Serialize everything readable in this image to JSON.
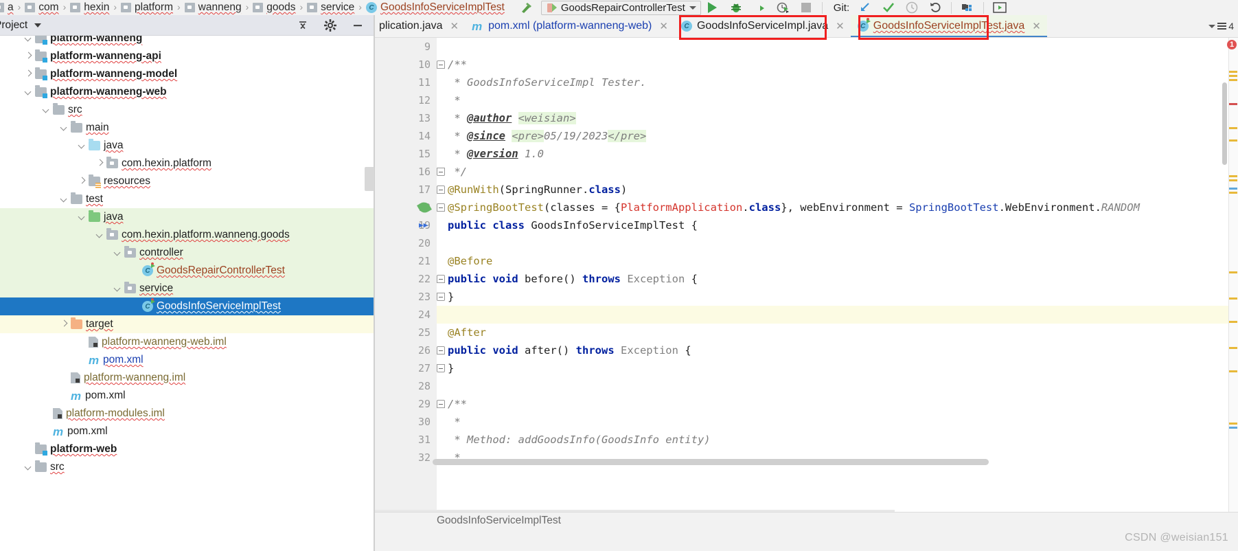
{
  "navbar": {
    "breadcrumbs": [
      {
        "label": "a",
        "icon": "package-icon",
        "kind": "package"
      },
      {
        "label": "com",
        "icon": "package-icon",
        "kind": "package"
      },
      {
        "label": "hexin",
        "icon": "package-icon",
        "kind": "package"
      },
      {
        "label": "platform",
        "icon": "package-icon",
        "kind": "package"
      },
      {
        "label": "wanneng",
        "icon": "package-icon",
        "kind": "package"
      },
      {
        "label": "goods",
        "icon": "package-icon",
        "kind": "package"
      },
      {
        "label": "service",
        "icon": "package-icon",
        "kind": "package"
      },
      {
        "label": "GoodsInfoServiceImplTest",
        "icon": "java-class-icon",
        "kind": "class"
      }
    ],
    "separator": "›",
    "build_icon": "hammer-icon",
    "run_config": {
      "name": "GoodsRepairControllerTest",
      "icon": "run-configuration-icon",
      "dropdown_icon": "chevron-down-icon"
    },
    "actions": [
      {
        "name": "run-button",
        "icon": "play-icon",
        "label": ""
      },
      {
        "name": "debug-button",
        "icon": "bug-icon",
        "label": ""
      },
      {
        "name": "run-with-coverage-button",
        "icon": "coverage-icon",
        "label": ""
      },
      {
        "name": "profile-button",
        "icon": "profiler-icon",
        "label": ""
      },
      {
        "name": "stop-button",
        "icon": "stop-square-icon",
        "label": ""
      }
    ],
    "git_label": "Git:",
    "git_actions": [
      {
        "name": "update-project-button",
        "icon": "arrow-down-left-icon"
      },
      {
        "name": "commit-button",
        "icon": "check-icon"
      },
      {
        "name": "history-button",
        "icon": "clock-icon"
      },
      {
        "name": "rollback-button",
        "icon": "undo-icon"
      },
      {
        "name": "project-structure-button",
        "icon": "project-structure-icon"
      },
      {
        "name": "preview-button",
        "icon": "preview-play-icon"
      }
    ]
  },
  "project_panel": {
    "title": "Project",
    "title_dropdown_icon": "chevron-down-icon",
    "collapse_all_icon": "collapse-all-icon",
    "settings_icon": "gear-icon",
    "hide_icon": "minimize-icon",
    "scroll_up_icon": "scroll-up-arrow-icon",
    "tree": [
      {
        "label": "platform-wanneng",
        "indent": 1,
        "arrow": "down",
        "icon": "module-folder-icon",
        "style": "bold",
        "clipped": true
      },
      {
        "label": "platform-wanneng-api",
        "indent": 1,
        "arrow": "right",
        "icon": "module-folder-icon",
        "style": "bold"
      },
      {
        "label": "platform-wanneng-model",
        "indent": 1,
        "arrow": "right",
        "icon": "module-folder-icon",
        "style": "bold"
      },
      {
        "label": "platform-wanneng-web",
        "indent": 1,
        "arrow": "down",
        "icon": "module-folder-icon",
        "style": "bold"
      },
      {
        "label": "src",
        "indent": 2,
        "arrow": "down",
        "icon": "folder-grey-icon"
      },
      {
        "label": "main",
        "indent": 3,
        "arrow": "down",
        "icon": "folder-grey-icon"
      },
      {
        "label": "java",
        "indent": 4,
        "arrow": "down",
        "icon": "folder-blue-source-icon"
      },
      {
        "label": "com.hexin.platform",
        "indent": 5,
        "arrow": "right",
        "icon": "package-icon"
      },
      {
        "label": "resources",
        "indent": 4,
        "arrow": "right",
        "icon": "folder-resources-icon"
      },
      {
        "label": "test",
        "indent": 3,
        "arrow": "down",
        "icon": "folder-grey-icon"
      },
      {
        "label": "java",
        "indent": 4,
        "arrow": "down",
        "icon": "folder-green-testsource-icon",
        "row": "test-scope"
      },
      {
        "label": "com.hexin.platform.wanneng.goods",
        "indent": 5,
        "arrow": "down",
        "icon": "package-icon",
        "row": "test-scope"
      },
      {
        "label": "controller",
        "indent": 6,
        "arrow": "down",
        "icon": "package-icon",
        "row": "test-scope"
      },
      {
        "label": "GoodsRepairControllerTest",
        "indent": 7,
        "arrow": "none",
        "icon": "java-test-class-icon",
        "row": "test-scope",
        "color": "class"
      },
      {
        "label": "service",
        "indent": 6,
        "arrow": "down",
        "icon": "package-icon",
        "row": "test-scope"
      },
      {
        "label": "GoodsInfoServiceImplTest",
        "indent": 7,
        "arrow": "none",
        "icon": "java-test-class-icon",
        "row": "selected"
      },
      {
        "label": "target",
        "indent": 3,
        "arrow": "right",
        "icon": "folder-excluded-icon",
        "row": "target"
      },
      {
        "label": "platform-wanneng-web.iml",
        "indent": 4,
        "arrow": "none",
        "icon": "iml-file-icon",
        "color": "iml"
      },
      {
        "label": "pom.xml",
        "indent": 4,
        "arrow": "none",
        "icon": "maven-file-icon",
        "color": "xml"
      },
      {
        "label": "platform-wanneng.iml",
        "indent": 3,
        "arrow": "none",
        "icon": "iml-file-icon",
        "color": "iml"
      },
      {
        "label": "pom.xml",
        "indent": 3,
        "arrow": "none",
        "icon": "maven-file-icon"
      },
      {
        "label": "platform-modules.iml",
        "indent": 2,
        "arrow": "none",
        "icon": "iml-file-icon",
        "color": "iml"
      },
      {
        "label": "pom.xml",
        "indent": 2,
        "arrow": "none",
        "icon": "maven-file-icon"
      },
      {
        "label": "platform-web",
        "indent": 1,
        "arrow": "none",
        "icon": "module-folder-icon",
        "style": "bold"
      },
      {
        "label": "src",
        "indent": 1,
        "arrow": "down",
        "icon": "folder-grey-icon"
      }
    ]
  },
  "editor_tabs": {
    "tabs": [
      {
        "label": "plication.java",
        "icon": "java-class-icon",
        "close_icon": "close-icon",
        "clipped": true,
        "state": "inactive"
      },
      {
        "label": "pom.xml (platform-wanneng-web)",
        "icon": "maven-file-icon",
        "close_icon": "close-icon",
        "state": "inactive"
      },
      {
        "label": "GoodsInfoServiceImpl.java",
        "icon": "java-class-icon",
        "close_icon": "close-icon",
        "state": "inactive",
        "highlighted": true
      },
      {
        "label": "GoodsInfoServiceImplTest.java",
        "icon": "java-test-class-icon",
        "close_icon": "close-icon",
        "state": "active",
        "highlighted": true
      }
    ],
    "right_controls": {
      "dropdown_icon": "chevron-down-icon",
      "list_icon": "tab-list-icon",
      "count": "4"
    }
  },
  "code": {
    "lines": [
      {
        "num": "9",
        "segments": []
      },
      {
        "num": "10",
        "fold": "start",
        "segments": [
          {
            "t": "/**",
            "c": "cm"
          }
        ]
      },
      {
        "num": "11",
        "segments": [
          {
            "t": " * GoodsInfoServiceImpl Tester.",
            "c": "cm"
          }
        ]
      },
      {
        "num": "12",
        "segments": [
          {
            "t": " *",
            "c": "cm"
          }
        ]
      },
      {
        "num": "13",
        "segments": [
          {
            "t": " * ",
            "c": "cm"
          },
          {
            "t": "@author",
            "c": "cmtag"
          },
          {
            "t": " ",
            "c": "cm"
          },
          {
            "t": "<weisian>",
            "c": "cmhl"
          }
        ]
      },
      {
        "num": "14",
        "segments": [
          {
            "t": " * ",
            "c": "cm"
          },
          {
            "t": "@since",
            "c": "cmtag"
          },
          {
            "t": " ",
            "c": "cm"
          },
          {
            "t": "<pre>",
            "c": "cmhl"
          },
          {
            "t": "05/19/2023",
            "c": "cm"
          },
          {
            "t": "</pre>",
            "c": "cmhl"
          }
        ]
      },
      {
        "num": "15",
        "segments": [
          {
            "t": " * ",
            "c": "cm"
          },
          {
            "t": "@version",
            "c": "cmtag"
          },
          {
            "t": " 1.0",
            "c": "cm"
          }
        ]
      },
      {
        "num": "16",
        "fold": "end",
        "segments": [
          {
            "t": " */",
            "c": "cm"
          }
        ]
      },
      {
        "num": "17",
        "fold": "start",
        "mark": "modified",
        "segments": [
          {
            "t": "@RunWith",
            "c": "ann"
          },
          {
            "t": "(SpringRunner.",
            "c": "typ"
          },
          {
            "t": "class",
            "c": "kw"
          },
          {
            "t": ")",
            "c": "typ"
          }
        ]
      },
      {
        "num": "18",
        "fold": "start",
        "mark": "spring-leaf",
        "segments": [
          {
            "t": "@SpringBootTest",
            "c": "ann"
          },
          {
            "t": "(classes = {",
            "c": "typ"
          },
          {
            "t": "PlatformApplication",
            "c": "red"
          },
          {
            "t": ".",
            "c": "typ"
          },
          {
            "t": "class",
            "c": "kw"
          },
          {
            "t": "}, webEnvironment = ",
            "c": "typ"
          },
          {
            "t": "SpringBootTest",
            "c": "blu"
          },
          {
            "t": ".WebEnvironment.",
            "c": "typ"
          },
          {
            "t": "RANDOM",
            "c": "itr"
          }
        ]
      },
      {
        "num": "19",
        "mark": "run-test",
        "segments": [
          {
            "t": "public ",
            "c": "kw"
          },
          {
            "t": "class ",
            "c": "kw"
          },
          {
            "t": "GoodsInfoServiceImplTest {",
            "c": "typ"
          }
        ]
      },
      {
        "num": "20",
        "segments": []
      },
      {
        "num": "21",
        "segments": [
          {
            "t": "@Before",
            "c": "ann"
          }
        ]
      },
      {
        "num": "22",
        "fold": "start",
        "segments": [
          {
            "t": "public ",
            "c": "kw"
          },
          {
            "t": "void ",
            "c": "kw"
          },
          {
            "t": "before() ",
            "c": "typ"
          },
          {
            "t": "throws ",
            "c": "kw"
          },
          {
            "t": "Exception",
            "c": "gry"
          },
          {
            "t": " {",
            "c": "typ"
          }
        ]
      },
      {
        "num": "23",
        "fold": "end",
        "segments": [
          {
            "t": "}",
            "c": "typ"
          }
        ]
      },
      {
        "num": "24",
        "highlight": true,
        "segments": []
      },
      {
        "num": "25",
        "segments": [
          {
            "t": "@After",
            "c": "ann"
          }
        ]
      },
      {
        "num": "26",
        "fold": "start",
        "segments": [
          {
            "t": "public ",
            "c": "kw"
          },
          {
            "t": "void ",
            "c": "kw"
          },
          {
            "t": "after() ",
            "c": "typ"
          },
          {
            "t": "throws ",
            "c": "kw"
          },
          {
            "t": "Exception",
            "c": "gry"
          },
          {
            "t": " {",
            "c": "typ"
          }
        ]
      },
      {
        "num": "27",
        "fold": "end",
        "segments": [
          {
            "t": "}",
            "c": "typ"
          }
        ]
      },
      {
        "num": "28",
        "segments": []
      },
      {
        "num": "29",
        "fold": "start",
        "segments": [
          {
            "t": "/**",
            "c": "cm"
          }
        ]
      },
      {
        "num": "30",
        "segments": [
          {
            "t": " *",
            "c": "cm"
          }
        ]
      },
      {
        "num": "31",
        "segments": [
          {
            "t": " * Method: addGoodsInfo(GoodsInfo entity)",
            "c": "cm"
          }
        ]
      },
      {
        "num": "32",
        "segments": [
          {
            "t": " *",
            "c": "cm"
          }
        ]
      }
    ],
    "error_badge": "1"
  },
  "bottom": {
    "breadcrumb": "GoodsInfoServiceImplTest",
    "watermark": "CSDN @weisian151"
  },
  "colors": {
    "selection_blue": "#1e77c4",
    "test_scope_green": "#eaf5e0",
    "target_yellow": "#fcfbe3",
    "annotation_red": "#f01f1f",
    "class_orange": "#9c4221",
    "xml_blue": "#1a3fb0"
  }
}
